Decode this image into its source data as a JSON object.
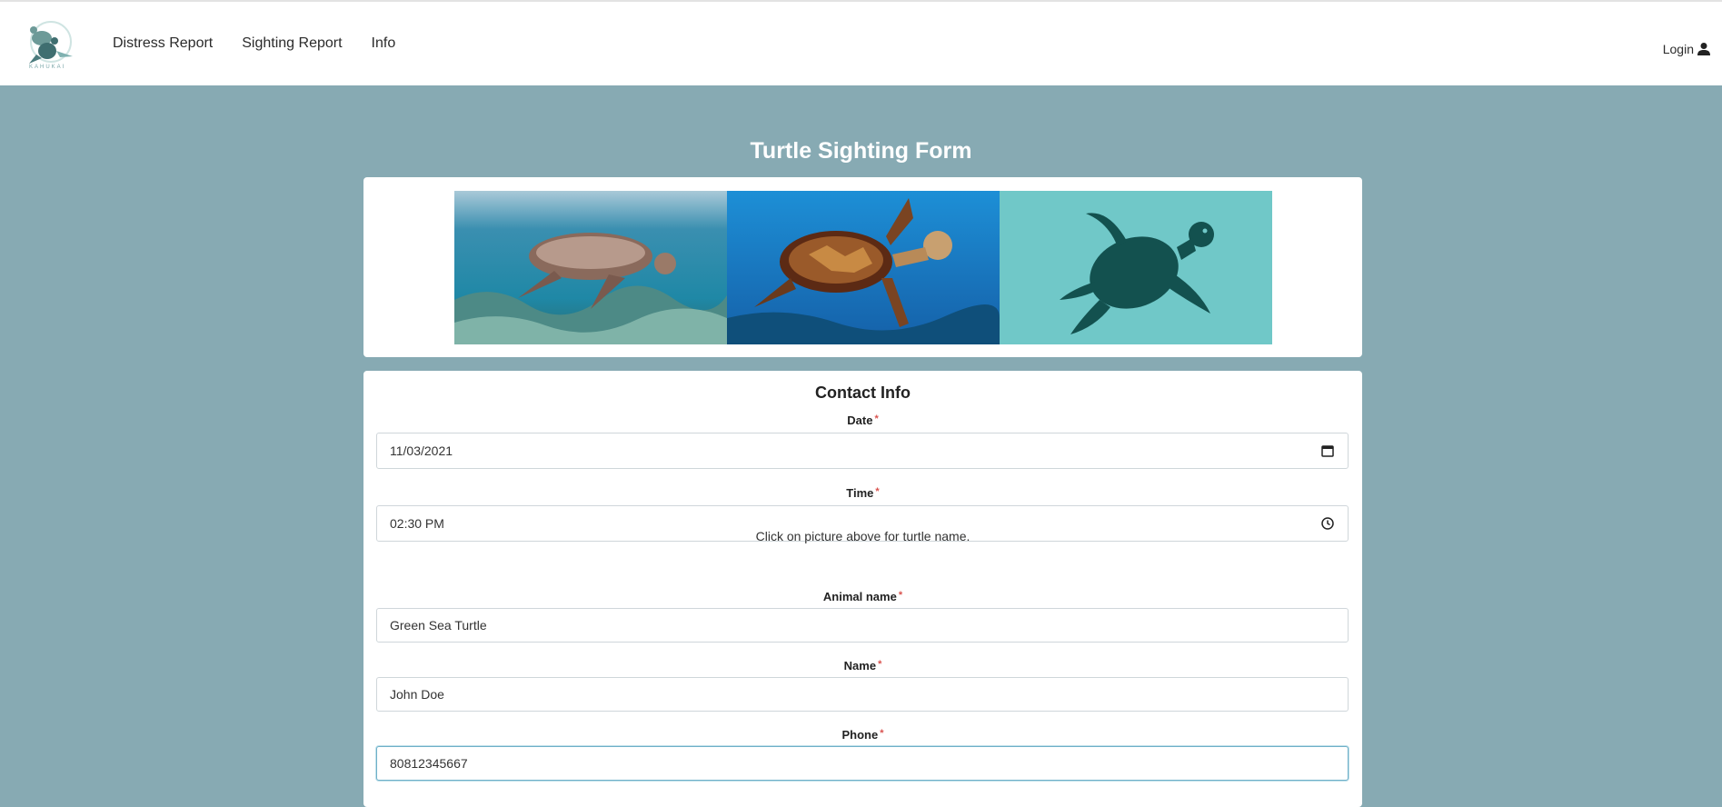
{
  "nav": {
    "logo_text": "KAHUKAI",
    "links": [
      "Distress Report",
      "Sighting Report",
      "Info"
    ],
    "login_label": "Login"
  },
  "page": {
    "title": "Turtle Sighting Form"
  },
  "gallery": {
    "images": [
      "turtle-underwater-photo",
      "hawksbill-turtle-photo",
      "turtle-silhouette-graphic"
    ]
  },
  "form": {
    "section_title": "Contact Info",
    "required_mark": "*",
    "date_label": "Date",
    "date_value": "11/03/2021",
    "time_label": "Time",
    "time_value": "02:30 PM",
    "hint": "Click on picture above for turtle name.",
    "animal_label": "Animal name",
    "animal_value": "Green Sea Turtle",
    "name_label": "Name",
    "name_value": "John Doe",
    "phone_label": "Phone",
    "phone_value": "80812345667"
  },
  "colors": {
    "background": "#87aab3",
    "required": "#d9534f",
    "silhouette_bg": "#70c8c8",
    "silhouette": "#13514f"
  }
}
